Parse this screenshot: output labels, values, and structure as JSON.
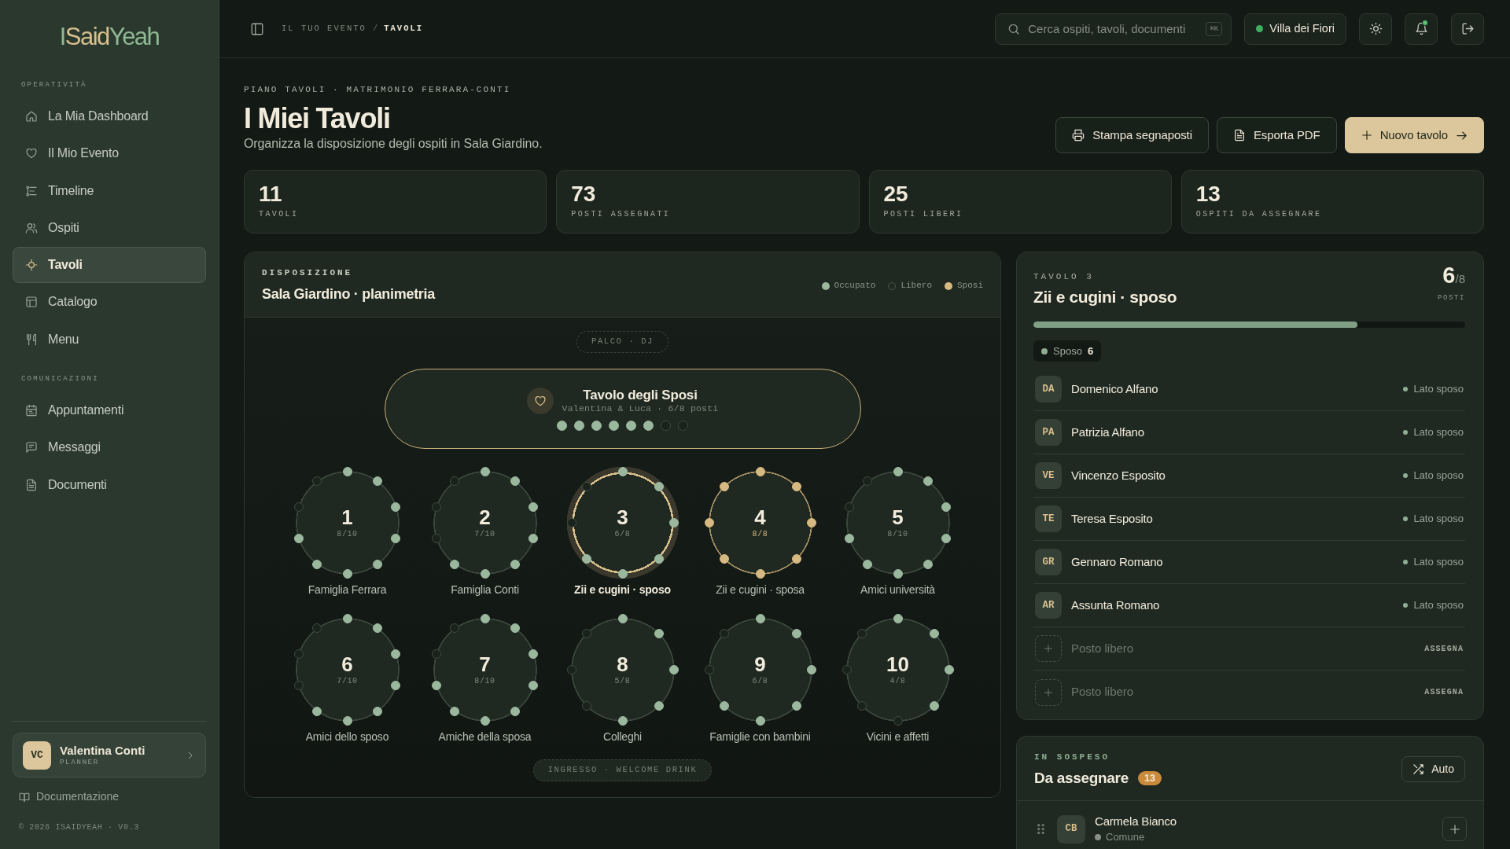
{
  "sidebar": {
    "logo": [
      {
        "text": "I",
        "color": "#8fb894"
      },
      {
        "text": "Said",
        "color": "#d9bf8c"
      },
      {
        "text": "Yeah",
        "color": "#8fb894"
      }
    ],
    "sections": [
      {
        "title": "OPERATIVITÀ",
        "items": [
          {
            "label": "La Mia Dashboard",
            "selected": false
          },
          {
            "label": "Il Mio Evento",
            "selected": false
          },
          {
            "label": "Timeline",
            "selected": false
          },
          {
            "label": "Ospiti",
            "selected": false
          },
          {
            "label": "Tavoli",
            "selected": true
          },
          {
            "label": "Catalogo",
            "selected": false
          },
          {
            "label": "Menu",
            "selected": false
          }
        ]
      },
      {
        "title": "COMUNICAZIONI",
        "items": [
          {
            "label": "Appuntamenti",
            "selected": false
          },
          {
            "label": "Messaggi",
            "selected": false
          },
          {
            "label": "Documenti",
            "selected": false
          }
        ]
      }
    ],
    "user": {
      "initials": "VC",
      "name": "Valentina Conti",
      "role": "PLANNER"
    },
    "docs_link": "Documentazione",
    "footer": "© 2026 ISAIDYEAH · V0.3"
  },
  "topbar": {
    "breadcrumb": [
      {
        "label": "IL TUO EVENTO",
        "current": false
      },
      {
        "label": "TAVOLI",
        "current": true
      }
    ],
    "separator": "/",
    "search": {
      "placeholder": "Cerca ospiti, tavoli, documenti",
      "shortcut": "⌘K"
    },
    "venue": "Villa dei Fiori",
    "notifications": {
      "unread": true
    }
  },
  "header": {
    "eyebrow": "PIANO TAVOLI · MATRIMONIO FERRARA-CONTI",
    "title": "I Miei Tavoli",
    "subtitle": "Organizza la disposizione degli ospiti in Sala Giardino.",
    "actions": [
      {
        "label": "Stampa segnaposti",
        "kind": "print"
      },
      {
        "label": "Esporta PDF",
        "kind": "export"
      },
      {
        "label": "Nuovo tavolo",
        "kind": "create"
      }
    ]
  },
  "stats": [
    {
      "value": "11",
      "label": "TAVOLI"
    },
    {
      "value": "73",
      "label": "POSTI ASSEGNATI"
    },
    {
      "value": "25",
      "label": "POSTI LIBERI"
    },
    {
      "value": "13",
      "label": "OSPITI DA ASSEGNARE"
    }
  ],
  "floor_plan": {
    "eyebrow": "DISPOSIZIONE",
    "title": "Sala Giardino · planimetria",
    "legend": [
      {
        "label": "Occupato",
        "kind": "occupied"
      },
      {
        "label": "Libero",
        "kind": "free"
      },
      {
        "label": "Sposi",
        "kind": "couple"
      }
    ],
    "stage": "PALCO · DJ",
    "head_table": {
      "title": "Tavolo degli Sposi",
      "subtitle": "Valentina & Luca · 6/8 posti",
      "seats": [
        {
          "occupied": true
        },
        {
          "occupied": true
        },
        {
          "occupied": true
        },
        {
          "occupied": true
        },
        {
          "occupied": true
        },
        {
          "occupied": true
        },
        {
          "occupied": false
        },
        {
          "occupied": false
        }
      ]
    },
    "tables": [
      {
        "number": "1",
        "count": "8/10",
        "name": "Famiglia Ferrara",
        "selected": false,
        "full": false,
        "seats": [
          {
            "occupied": true
          },
          {
            "occupied": true
          },
          {
            "occupied": true
          },
          {
            "occupied": true
          },
          {
            "occupied": true
          },
          {
            "occupied": true
          },
          {
            "occupied": true
          },
          {
            "occupied": true
          },
          {
            "occupied": false
          },
          {
            "occupied": false
          }
        ]
      },
      {
        "number": "2",
        "count": "7/10",
        "name": "Famiglia Conti",
        "selected": false,
        "full": false,
        "seats": [
          {
            "occupied": true
          },
          {
            "occupied": true
          },
          {
            "occupied": true
          },
          {
            "occupied": true
          },
          {
            "occupied": true
          },
          {
            "occupied": true
          },
          {
            "occupied": true
          },
          {
            "occupied": false
          },
          {
            "occupied": false
          },
          {
            "occupied": false
          }
        ]
      },
      {
        "number": "3",
        "count": "6/8",
        "name": "Zii e cugini · sposo",
        "selected": true,
        "full": false,
        "seats": [
          {
            "occupied": true
          },
          {
            "occupied": true
          },
          {
            "occupied": true
          },
          {
            "occupied": true
          },
          {
            "occupied": true
          },
          {
            "occupied": true
          },
          {
            "occupied": false
          },
          {
            "occupied": false
          }
        ]
      },
      {
        "number": "4",
        "count": "8/8",
        "name": "Zii e cugini · sposa",
        "selected": false,
        "full": true,
        "seats": [
          {
            "occupied": true
          },
          {
            "occupied": true
          },
          {
            "occupied": true
          },
          {
            "occupied": true
          },
          {
            "occupied": true
          },
          {
            "occupied": true
          },
          {
            "occupied": true
          },
          {
            "occupied": true
          }
        ]
      },
      {
        "number": "5",
        "count": "8/10",
        "name": "Amici università",
        "selected": false,
        "full": false,
        "seats": [
          {
            "occupied": true
          },
          {
            "occupied": true
          },
          {
            "occupied": true
          },
          {
            "occupied": true
          },
          {
            "occupied": true
          },
          {
            "occupied": true
          },
          {
            "occupied": true
          },
          {
            "occupied": true
          },
          {
            "occupied": false
          },
          {
            "occupied": false
          }
        ]
      },
      {
        "number": "6",
        "count": "7/10",
        "name": "Amici dello sposo",
        "selected": false,
        "full": false,
        "seats": [
          {
            "occupied": true
          },
          {
            "occupied": true
          },
          {
            "occupied": true
          },
          {
            "occupied": true
          },
          {
            "occupied": true
          },
          {
            "occupied": true
          },
          {
            "occupied": true
          },
          {
            "occupied": false
          },
          {
            "occupied": false
          },
          {
            "occupied": false
          }
        ]
      },
      {
        "number": "7",
        "count": "8/10",
        "name": "Amiche della sposa",
        "selected": false,
        "full": false,
        "seats": [
          {
            "occupied": true
          },
          {
            "occupied": true
          },
          {
            "occupied": true
          },
          {
            "occupied": true
          },
          {
            "occupied": true
          },
          {
            "occupied": true
          },
          {
            "occupied": true
          },
          {
            "occupied": true
          },
          {
            "occupied": false
          },
          {
            "occupied": false
          }
        ]
      },
      {
        "number": "8",
        "count": "5/8",
        "name": "Colleghi",
        "selected": false,
        "full": false,
        "seats": [
          {
            "occupied": true
          },
          {
            "occupied": true
          },
          {
            "occupied": true
          },
          {
            "occupied": true
          },
          {
            "occupied": true
          },
          {
            "occupied": false
          },
          {
            "occupied": false
          },
          {
            "occupied": false
          }
        ]
      },
      {
        "number": "9",
        "count": "6/8",
        "name": "Famiglie con bambini",
        "selected": false,
        "full": false,
        "seats": [
          {
            "occupied": true
          },
          {
            "occupied": true
          },
          {
            "occupied": true
          },
          {
            "occupied": true
          },
          {
            "occupied": true
          },
          {
            "occupied": true
          },
          {
            "occupied": false
          },
          {
            "occupied": false
          }
        ]
      },
      {
        "number": "10",
        "count": "4/8",
        "name": "Vicini e affetti",
        "selected": false,
        "full": false,
        "seats": [
          {
            "occupied": true
          },
          {
            "occupied": true
          },
          {
            "occupied": true
          },
          {
            "occupied": true
          },
          {
            "occupied": false
          },
          {
            "occupied": false
          },
          {
            "occupied": false
          },
          {
            "occupied": false
          }
        ]
      }
    ],
    "entrance": "INGRESSO · WELCOME DRINK"
  },
  "detail": {
    "eyebrow": "TAVOLO 3",
    "title": "Zii e cugini · sposo",
    "taken": "6",
    "capacity": "/8",
    "unit": "POSTI",
    "level": 0.75,
    "chip": {
      "label": "Sposo",
      "count": "6"
    },
    "rows": [
      {
        "kind": "guest",
        "initials": "DA",
        "name": "Domenico Alfano",
        "group": "Lato sposo",
        "color": "#8fae94"
      },
      {
        "kind": "guest",
        "initials": "PA",
        "name": "Patrizia Alfano",
        "group": "Lato sposo",
        "color": "#8fae94"
      },
      {
        "kind": "guest",
        "initials": "VE",
        "name": "Vincenzo Esposito",
        "group": "Lato sposo",
        "color": "#8fae94"
      },
      {
        "kind": "guest",
        "initials": "TE",
        "name": "Teresa Esposito",
        "group": "Lato sposo",
        "color": "#8fae94"
      },
      {
        "kind": "guest",
        "initials": "GR",
        "name": "Gennaro Romano",
        "group": "Lato sposo",
        "color": "#8fae94"
      },
      {
        "kind": "guest",
        "initials": "AR",
        "name": "Assunta Romano",
        "group": "Lato sposo",
        "color": "#8fae94"
      },
      {
        "kind": "free",
        "label": "Posto libero",
        "action": "ASSEGNA"
      },
      {
        "kind": "free",
        "label": "Posto libero",
        "action": "ASSEGNA"
      }
    ]
  },
  "pending": {
    "eyebrow": "IN SOSPESO",
    "title": "Da assegnare",
    "count": "13",
    "action": "Auto",
    "guests": [
      {
        "initials": "CB",
        "name": "Carmela Bianco",
        "group": "Comune",
        "color": "#8a8f88"
      }
    ]
  }
}
